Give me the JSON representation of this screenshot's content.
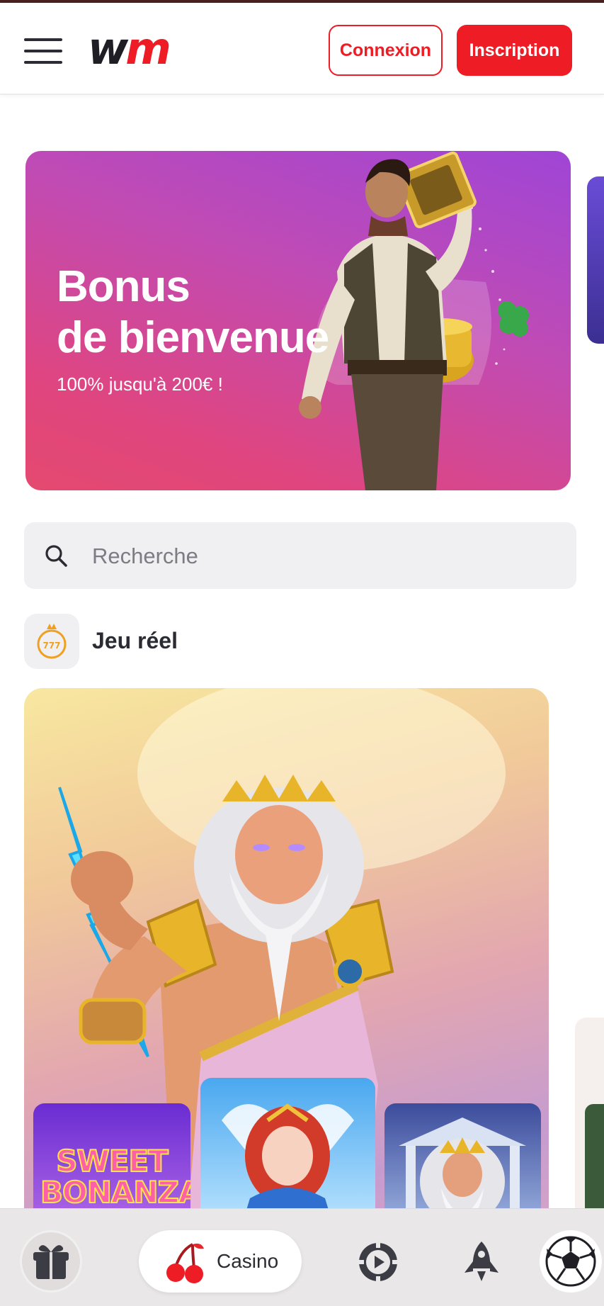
{
  "header": {
    "logo": {
      "w": "w",
      "m": "m"
    },
    "login_label": "Connexion",
    "signup_label": "Inscription"
  },
  "banner": {
    "title_line1": "Bonus",
    "title_line2": "de bienvenue",
    "subtitle": "100% jusqu'à 200€ !"
  },
  "search": {
    "placeholder": "Recherche"
  },
  "section": {
    "title": "Jeu réel",
    "badge_text": "777"
  },
  "games": {
    "thumb1_title": "SWEET BONANZA"
  },
  "bottom_nav": {
    "casino_label": "Casino",
    "items": [
      "gift-icon",
      "cherry-icon",
      "live-casino-icon",
      "rocket-icon",
      "soccer-ball-icon"
    ]
  },
  "colors": {
    "brand_red": "#ee1c24",
    "dark": "#2b2b33",
    "banner_purple": "#9f45d6",
    "banner_pink": "#e44a6f"
  }
}
